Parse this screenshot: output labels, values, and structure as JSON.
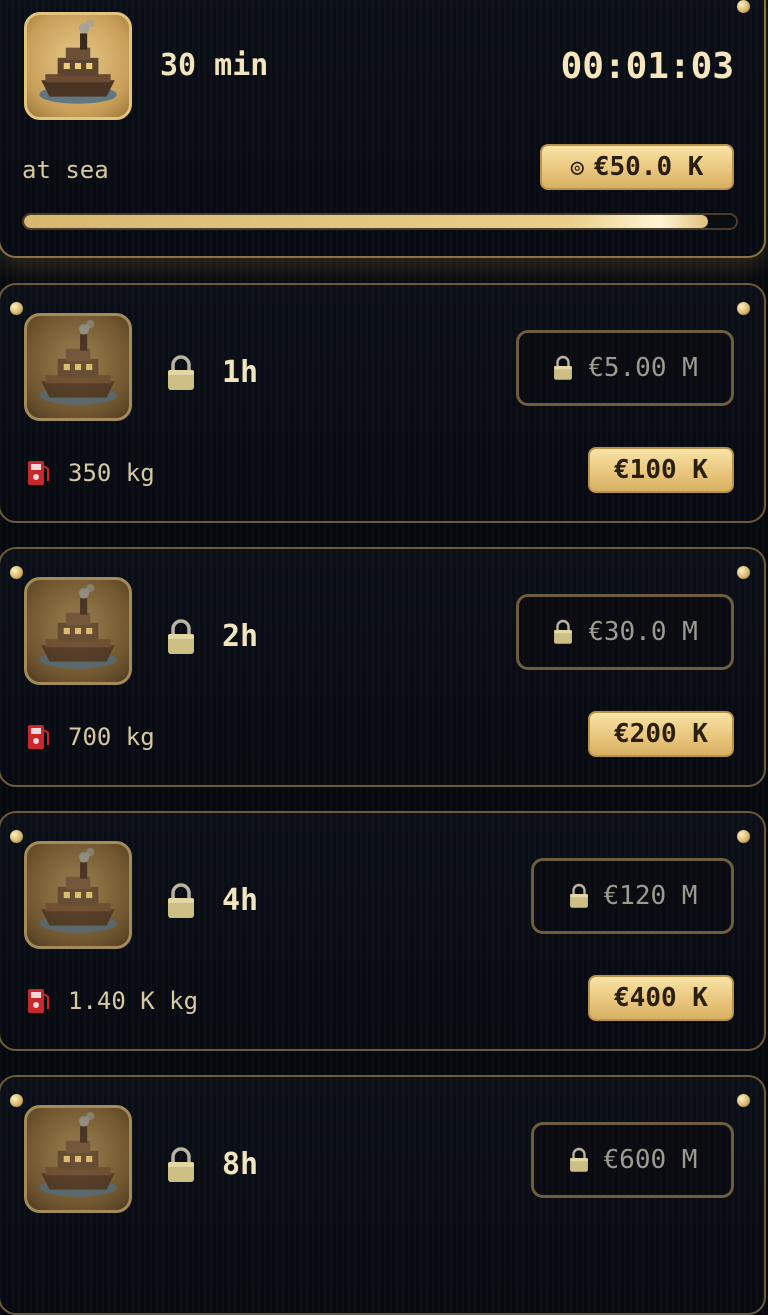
{
  "active_trip": {
    "duration": "30 min",
    "timer": "00:01:03",
    "status": "at sea",
    "reward_icon": "coin-icon",
    "reward_glyph": "◎",
    "reward": "€50.0 K",
    "progress_fraction": 0.96
  },
  "boats": [
    {
      "duration": "1h",
      "unlock_price": "€5.00 M",
      "fuel": "350 kg",
      "reward": "€100 K",
      "locked": true
    },
    {
      "duration": "2h",
      "unlock_price": "€30.0 M",
      "fuel": "700 kg",
      "reward": "€200 K",
      "locked": true
    },
    {
      "duration": "4h",
      "unlock_price": "€120 M",
      "fuel": "1.40 K kg",
      "reward": "€400 K",
      "locked": true
    },
    {
      "duration": "8h",
      "unlock_price": "€600 M",
      "locked": true
    }
  ],
  "colors": {
    "accent_gold": "#e9c77d",
    "background": "#05080d",
    "border": "#6e5a3a",
    "fuel_red": "#c8272e"
  }
}
